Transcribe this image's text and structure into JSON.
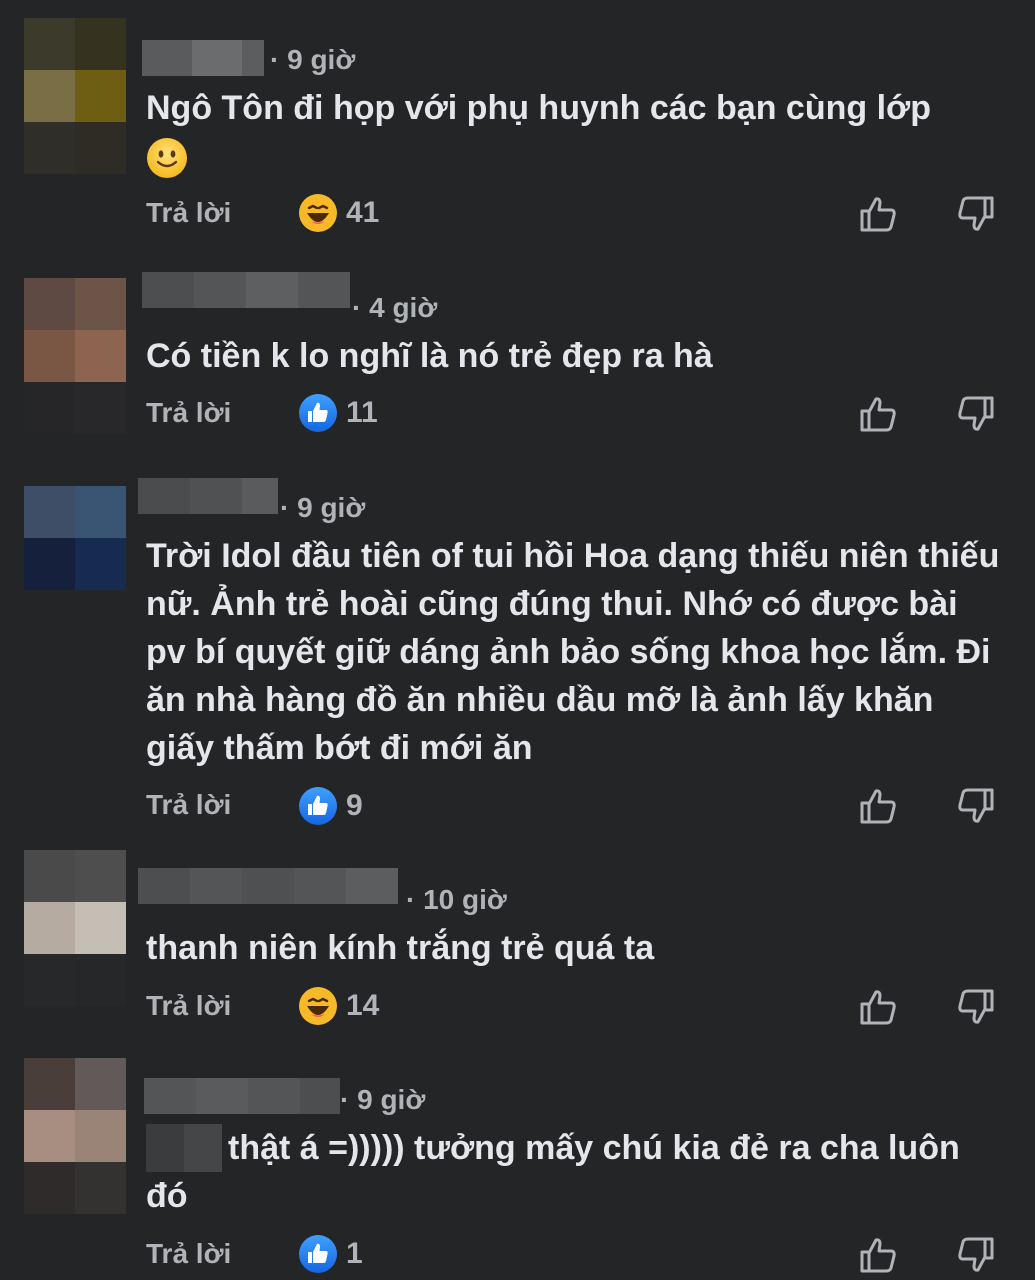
{
  "comments": [
    {
      "time": "· 9 giờ",
      "text": "Ngô Tôn đi họp với phụ huynh các bạn cùng lớp",
      "reply_label": "Trả lời",
      "reaction_icon": "haha-emoji-icon",
      "reaction_count": "41"
    },
    {
      "time": "· 4 giờ",
      "text": "Có tiền k lo nghĩ là nó trẻ đẹp ra hà",
      "reply_label": "Trả lời",
      "reaction_icon": "like-reaction-icon",
      "reaction_count": "11"
    },
    {
      "time": "· 9 giờ",
      "text": "Trời Idol đầu tiên of tui hồi Hoa dạng thiếu niên thiếu nữ. Ảnh trẻ hoài cũng đúng thui. Nhớ có được bài pv bí quyết giữ dáng ảnh bảo sống khoa học lắm. Đi ăn nhà hàng đồ ăn nhiều dầu mỡ là ảnh lấy khăn giấy thấm bớt đi mới ăn",
      "reply_label": "Trả lời",
      "reaction_icon": "like-reaction-icon",
      "reaction_count": "9"
    },
    {
      "time": "· 10 giờ",
      "text": "thanh niên kính trắng trẻ quá ta",
      "reply_label": "Trả lời",
      "reaction_icon": "haha-emoji-icon",
      "reaction_count": "14"
    },
    {
      "time": "· 9 giờ",
      "text": "thật á =))))) tưởng mấy chú kia đẻ ra cha luôn đó",
      "reply_label": "Trả lời",
      "reaction_icon": "like-reaction-icon",
      "reaction_count": "1"
    }
  ],
  "colors": {
    "background": "#242526",
    "text_primary": "#e4e6eb",
    "text_secondary": "#b0b3b8",
    "like_blue": "#1877f2",
    "haha_yellow": "#f7b928"
  }
}
